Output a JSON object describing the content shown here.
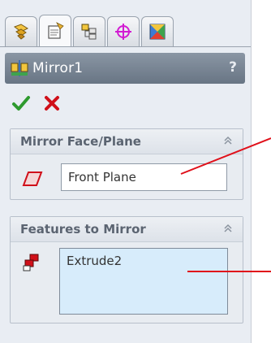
{
  "tabs": [
    {
      "name": "feature-manager-tab",
      "icon": "feature-tree-icon"
    },
    {
      "name": "property-manager-tab",
      "icon": "property-manager-icon",
      "active": true
    },
    {
      "name": "configuration-manager-tab",
      "icon": "configuration-icon"
    },
    {
      "name": "dimxpert-tab",
      "icon": "crosshair-icon"
    },
    {
      "name": "display-manager-tab",
      "icon": "display-manager-icon"
    }
  ],
  "title": {
    "text": "Mirror1",
    "help": "?"
  },
  "actions": {
    "ok_icon": "checkmark-icon",
    "cancel_icon": "x-icon"
  },
  "mirror_face": {
    "title": "Mirror Face/Plane",
    "value": "Front Plane"
  },
  "features": {
    "title": "Features to Mirror",
    "value": "Extrude2"
  },
  "colors": {
    "title_bar": "#7a8695",
    "selection_box": "#d7ecfb",
    "callout": "#e0101a",
    "ok": "#2e9a2e",
    "cancel": "#d0101a"
  }
}
